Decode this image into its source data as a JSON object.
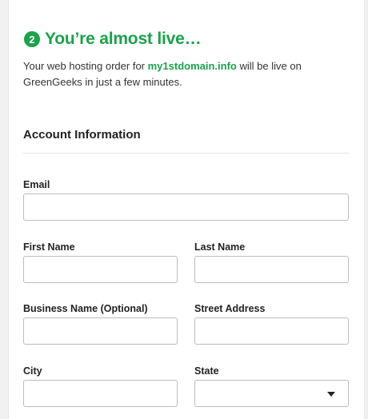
{
  "header": {
    "step_number": "2",
    "title": "You’re almost live…"
  },
  "intro": {
    "text_before": "Your web hosting order for ",
    "domain": "my1stdomain.info",
    "text_after": " will be live on GreenGeeks in just a few minutes."
  },
  "section": {
    "heading": "Account Information"
  },
  "form": {
    "email": {
      "label": "Email",
      "value": ""
    },
    "first_name": {
      "label": "First Name",
      "value": ""
    },
    "last_name": {
      "label": "Last Name",
      "value": ""
    },
    "business_name": {
      "label": "Business Name (Optional)",
      "value": ""
    },
    "street_address": {
      "label": "Street Address",
      "value": ""
    },
    "city": {
      "label": "City",
      "value": ""
    },
    "state": {
      "label": "State",
      "value": ""
    }
  },
  "colors": {
    "brand_green": "#1aa34a",
    "border": "#bdbdbd",
    "background": "#f1f1f1"
  },
  "icons": {
    "state_dropdown": "caret-down-icon"
  }
}
